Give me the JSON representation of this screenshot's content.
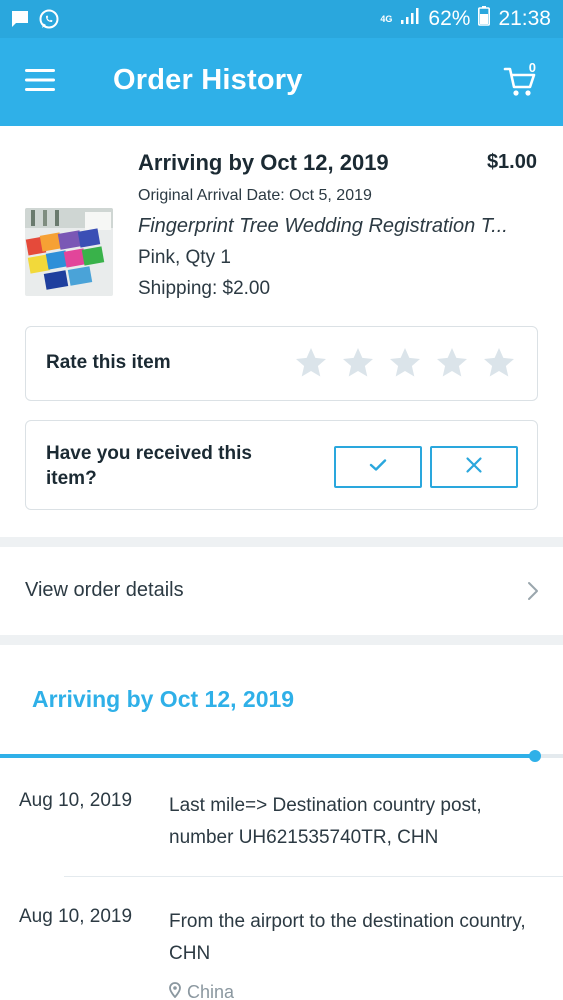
{
  "status_bar": {
    "network": "4G",
    "battery": "62%",
    "time": "21:38"
  },
  "app_bar": {
    "title": "Order History",
    "cart_count": "0"
  },
  "order_item": {
    "arrival_title": "Arriving by Oct 12, 2019",
    "price": "$1.00",
    "original_arrival": "Original Arrival Date: Oct 5, 2019",
    "product_name": "Fingerprint Tree Wedding Registration T...",
    "variant": "Pink, Qty 1",
    "shipping": "Shipping: $2.00"
  },
  "rating": {
    "label": "Rate this item",
    "stars_total": 5,
    "stars_selected": 0,
    "star_color": "#dbe4ea"
  },
  "received": {
    "label": "Have you received this item?"
  },
  "order_details": {
    "label": "View order details"
  },
  "tracking": {
    "title": "Arriving by Oct 12, 2019",
    "progress": 0.95,
    "accent_color": "#2fb0e8",
    "events": [
      {
        "date": "Aug 10, 2019",
        "description": "Last mile=> Destination country post, number UH621535740TR, CHN"
      },
      {
        "date": "Aug 10, 2019",
        "description": "From the airport to the destination country, CHN",
        "location": "China"
      }
    ]
  },
  "icons": {
    "status_left": [
      "chat-bubble-icon",
      "whatsapp-icon"
    ],
    "status_right": [
      "network-icon",
      "signal-icon",
      "battery-icon"
    ],
    "app_bar": [
      "menu-icon",
      "cart-icon"
    ],
    "received": [
      "check-icon",
      "close-icon"
    ],
    "order_details": [
      "chevron-right-icon"
    ],
    "tracking": [
      "location-pin-icon"
    ]
  }
}
